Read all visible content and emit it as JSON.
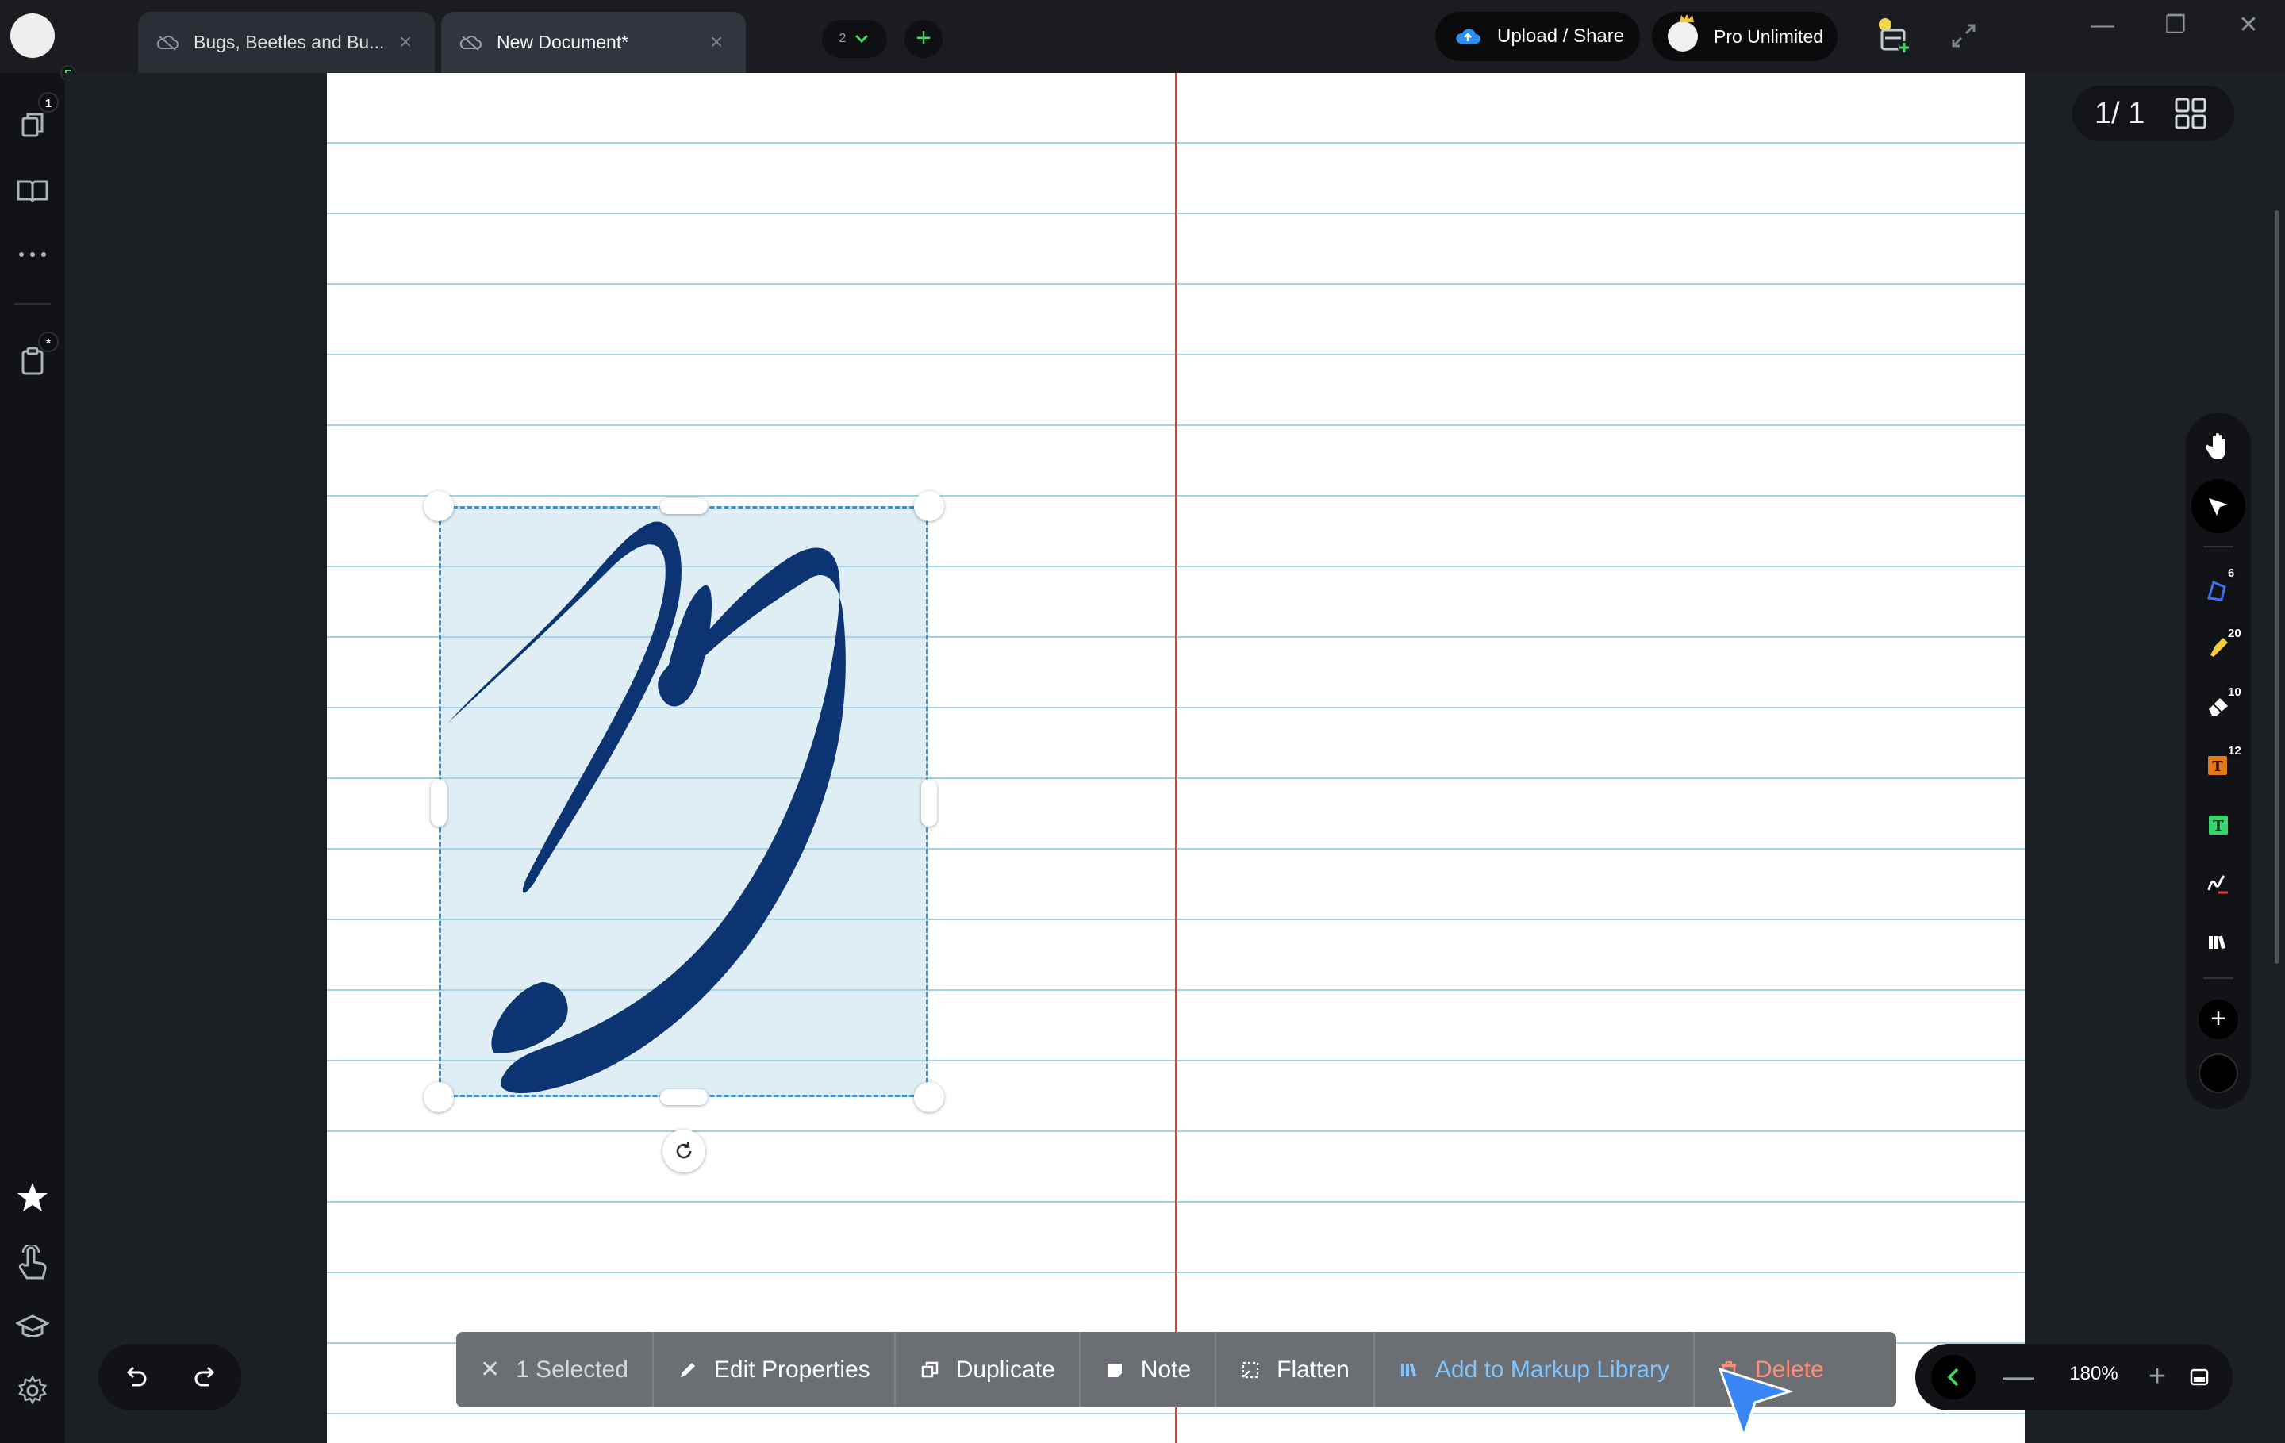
{
  "titlebar": {
    "tabs": [
      {
        "label": "Bugs, Beetles and Bu...",
        "close": "×"
      },
      {
        "label": "New Document*",
        "close": "×"
      }
    ],
    "doc_count": "2",
    "new_tab_icon": "+",
    "upload_label": "Upload / Share",
    "pro_label": "Pro Unlimited",
    "window_controls": {
      "minimize": "—",
      "restore": "❐",
      "close": "✕"
    }
  },
  "left_sidebar": {
    "pages_badge": "1",
    "clipboard_badge": "*"
  },
  "page_counter": {
    "text": "1/ 1"
  },
  "right_toolbar": {
    "badges": {
      "shapes": "6",
      "highlighter": "20",
      "eraser": "10",
      "text": "12"
    },
    "add_icon": "+",
    "current_color": "#000000"
  },
  "action_bar": {
    "selected_icon": "✕",
    "selected_label": "1 Selected",
    "edit_label": "Edit Properties",
    "duplicate_label": "Duplicate",
    "note_label": "Note",
    "flatten_label": "Flatten",
    "library_label": "Add to Markup Library",
    "delete_label": "Delete"
  },
  "zoom": {
    "minus": "—",
    "value": "180%",
    "plus": "+"
  },
  "colors": {
    "margin_line": "#e63b3b",
    "rule_line": "#9ed4e6",
    "signature": "#0d3472",
    "selection_border": "#3d8ed0",
    "accent_green": "#3ddc60",
    "library_blue": "#7ec4ff",
    "delete_red": "#ff8c76"
  }
}
